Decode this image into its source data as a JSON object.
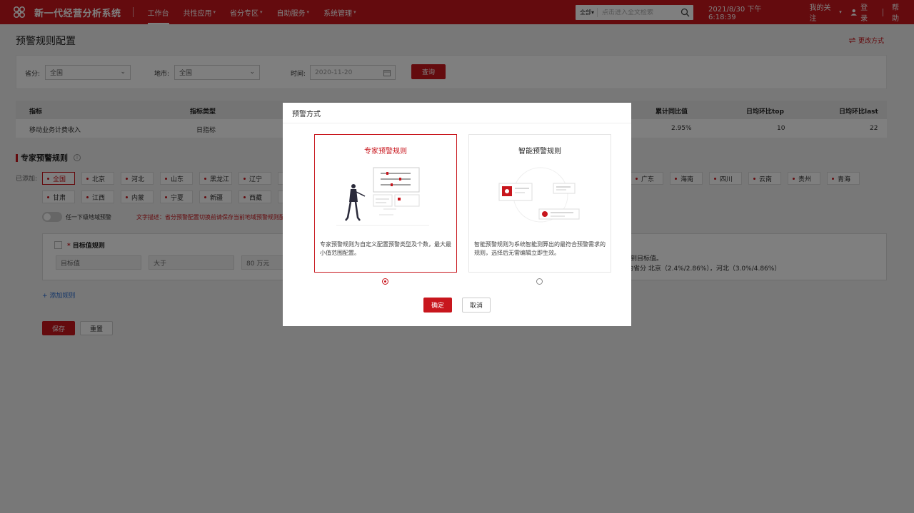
{
  "app": {
    "title": "新一代经营分析系统"
  },
  "nav": {
    "items": [
      {
        "label": "工作台"
      },
      {
        "label": "共性应用"
      },
      {
        "label": "省分专区"
      },
      {
        "label": "自助服务"
      },
      {
        "label": "系统管理"
      }
    ]
  },
  "search": {
    "scope": "全部",
    "placeholder": "点击进入全文检索"
  },
  "topbar": {
    "datetime": "2021/8/30 下午6:18:39",
    "my_follow": "我的关注",
    "login": "登录",
    "help": "帮助"
  },
  "page": {
    "title": "预警规则配置",
    "change_mode": "更改方式"
  },
  "filter": {
    "province_label": "省分:",
    "province_value": "全国",
    "city_label": "地市:",
    "city_value": "全国",
    "time_label": "时间:",
    "time_value": "2020-11-20",
    "query_btn": "查询"
  },
  "table": {
    "headers": [
      "指标",
      "指标类型",
      "累计同比值",
      "日均环比top",
      "日均环比last"
    ],
    "row": [
      "移动业务计费收入",
      "日指标",
      "2.95%",
      "10",
      "22"
    ]
  },
  "expert_section": {
    "title": "专家预警规则",
    "added_label": "已添加:",
    "regions_row1_left": [
      "全国",
      "北京",
      "河北",
      "山东",
      "黑龙江",
      "辽宁"
    ],
    "regions_row1_right": [
      "广东",
      "海南",
      "四川",
      "云南",
      "贵州",
      "青海"
    ],
    "regions_row2": [
      "甘肃",
      "江西",
      "内蒙",
      "宁夏",
      "新疆",
      "西藏"
    ],
    "toggle_label": "任一下级地域预警",
    "desc": "文字描述：省分预警配置切换前请保存当前地域预警规则配"
  },
  "rule": {
    "title": "目标值规则",
    "fields": [
      "目标值",
      "大于",
      "80 万元"
    ],
    "note1": "达到目标值。",
    "note2": "约省分 北京（2.4%/2.86%），河北（3.0%/4.86%）",
    "add_rule": "+ 添加规则"
  },
  "actions": {
    "save": "保存",
    "reset": "重置"
  },
  "modal": {
    "title": "预警方式",
    "expert": {
      "title": "专家预警规则",
      "desc": "专家预警规则为自定义配置预警类型及个数，最大最小值范围配置。"
    },
    "smart": {
      "title": "智能预警规则",
      "desc": "智能预警规则为系统智能测算出的最符合预警需求的规则，选择后无需编辑立即生效。"
    },
    "ok": "确定",
    "cancel": "取消",
    "selected": "expert"
  },
  "colors": {
    "brand": "#c8161d",
    "link": "#2d6fd2"
  }
}
